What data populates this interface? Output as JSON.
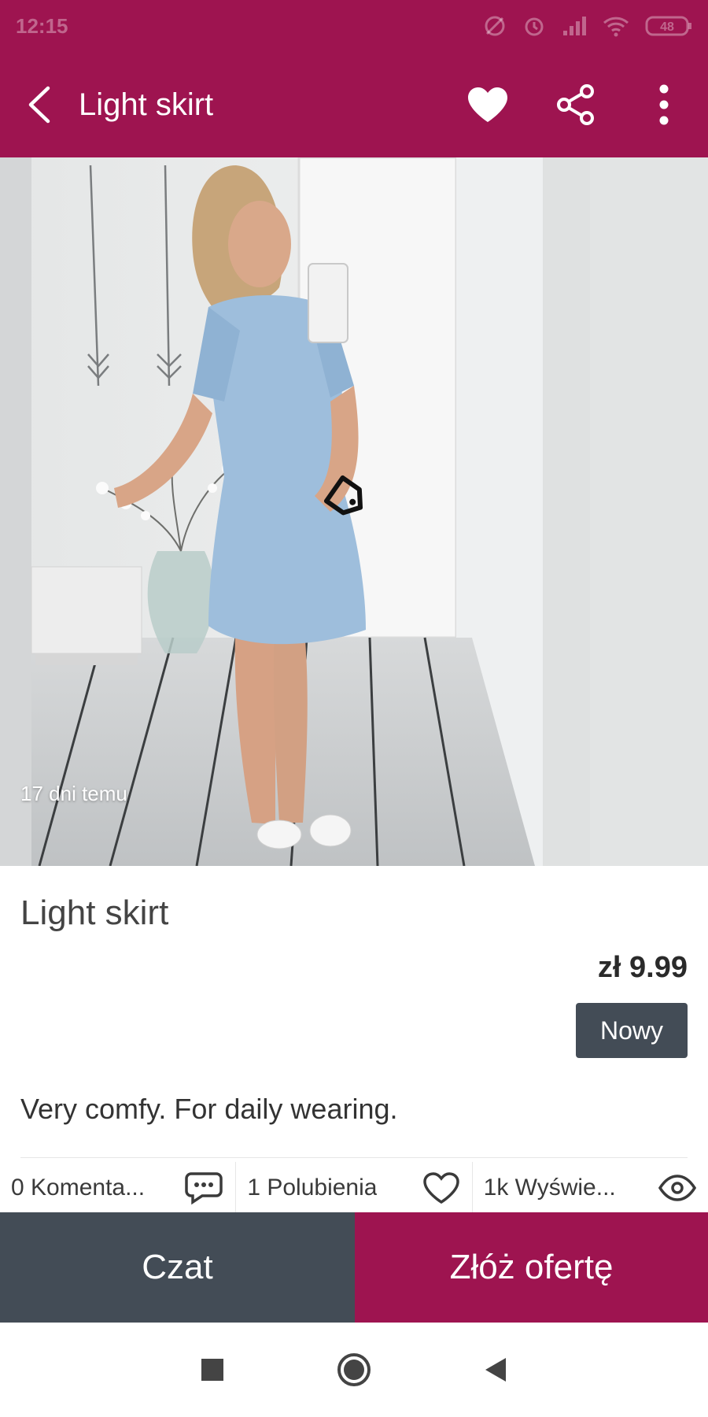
{
  "status_bar": {
    "time": "12:15",
    "battery": "48"
  },
  "app_bar": {
    "title": "Light skirt",
    "back_icon": "back-arrow-icon",
    "favorite_icon": "heart-filled-icon",
    "share_icon": "share-icon",
    "menu_icon": "more-vertical-icon"
  },
  "photo": {
    "posted_ago": "17 dni temu",
    "tag_icon": "price-tag-icon"
  },
  "listing": {
    "title": "Light skirt",
    "price": "zł 9.99",
    "condition": "Nowy",
    "description": "Very comfy. For daily wearing."
  },
  "stats": {
    "comments": "0 Komenta...",
    "likes": "1 Polubienia",
    "views": "1k Wyświe..."
  },
  "actions": {
    "chat": "Czat",
    "make_offer": "Złóż ofertę"
  },
  "colors": {
    "brand": "#9e1450",
    "dark": "#434c56"
  }
}
